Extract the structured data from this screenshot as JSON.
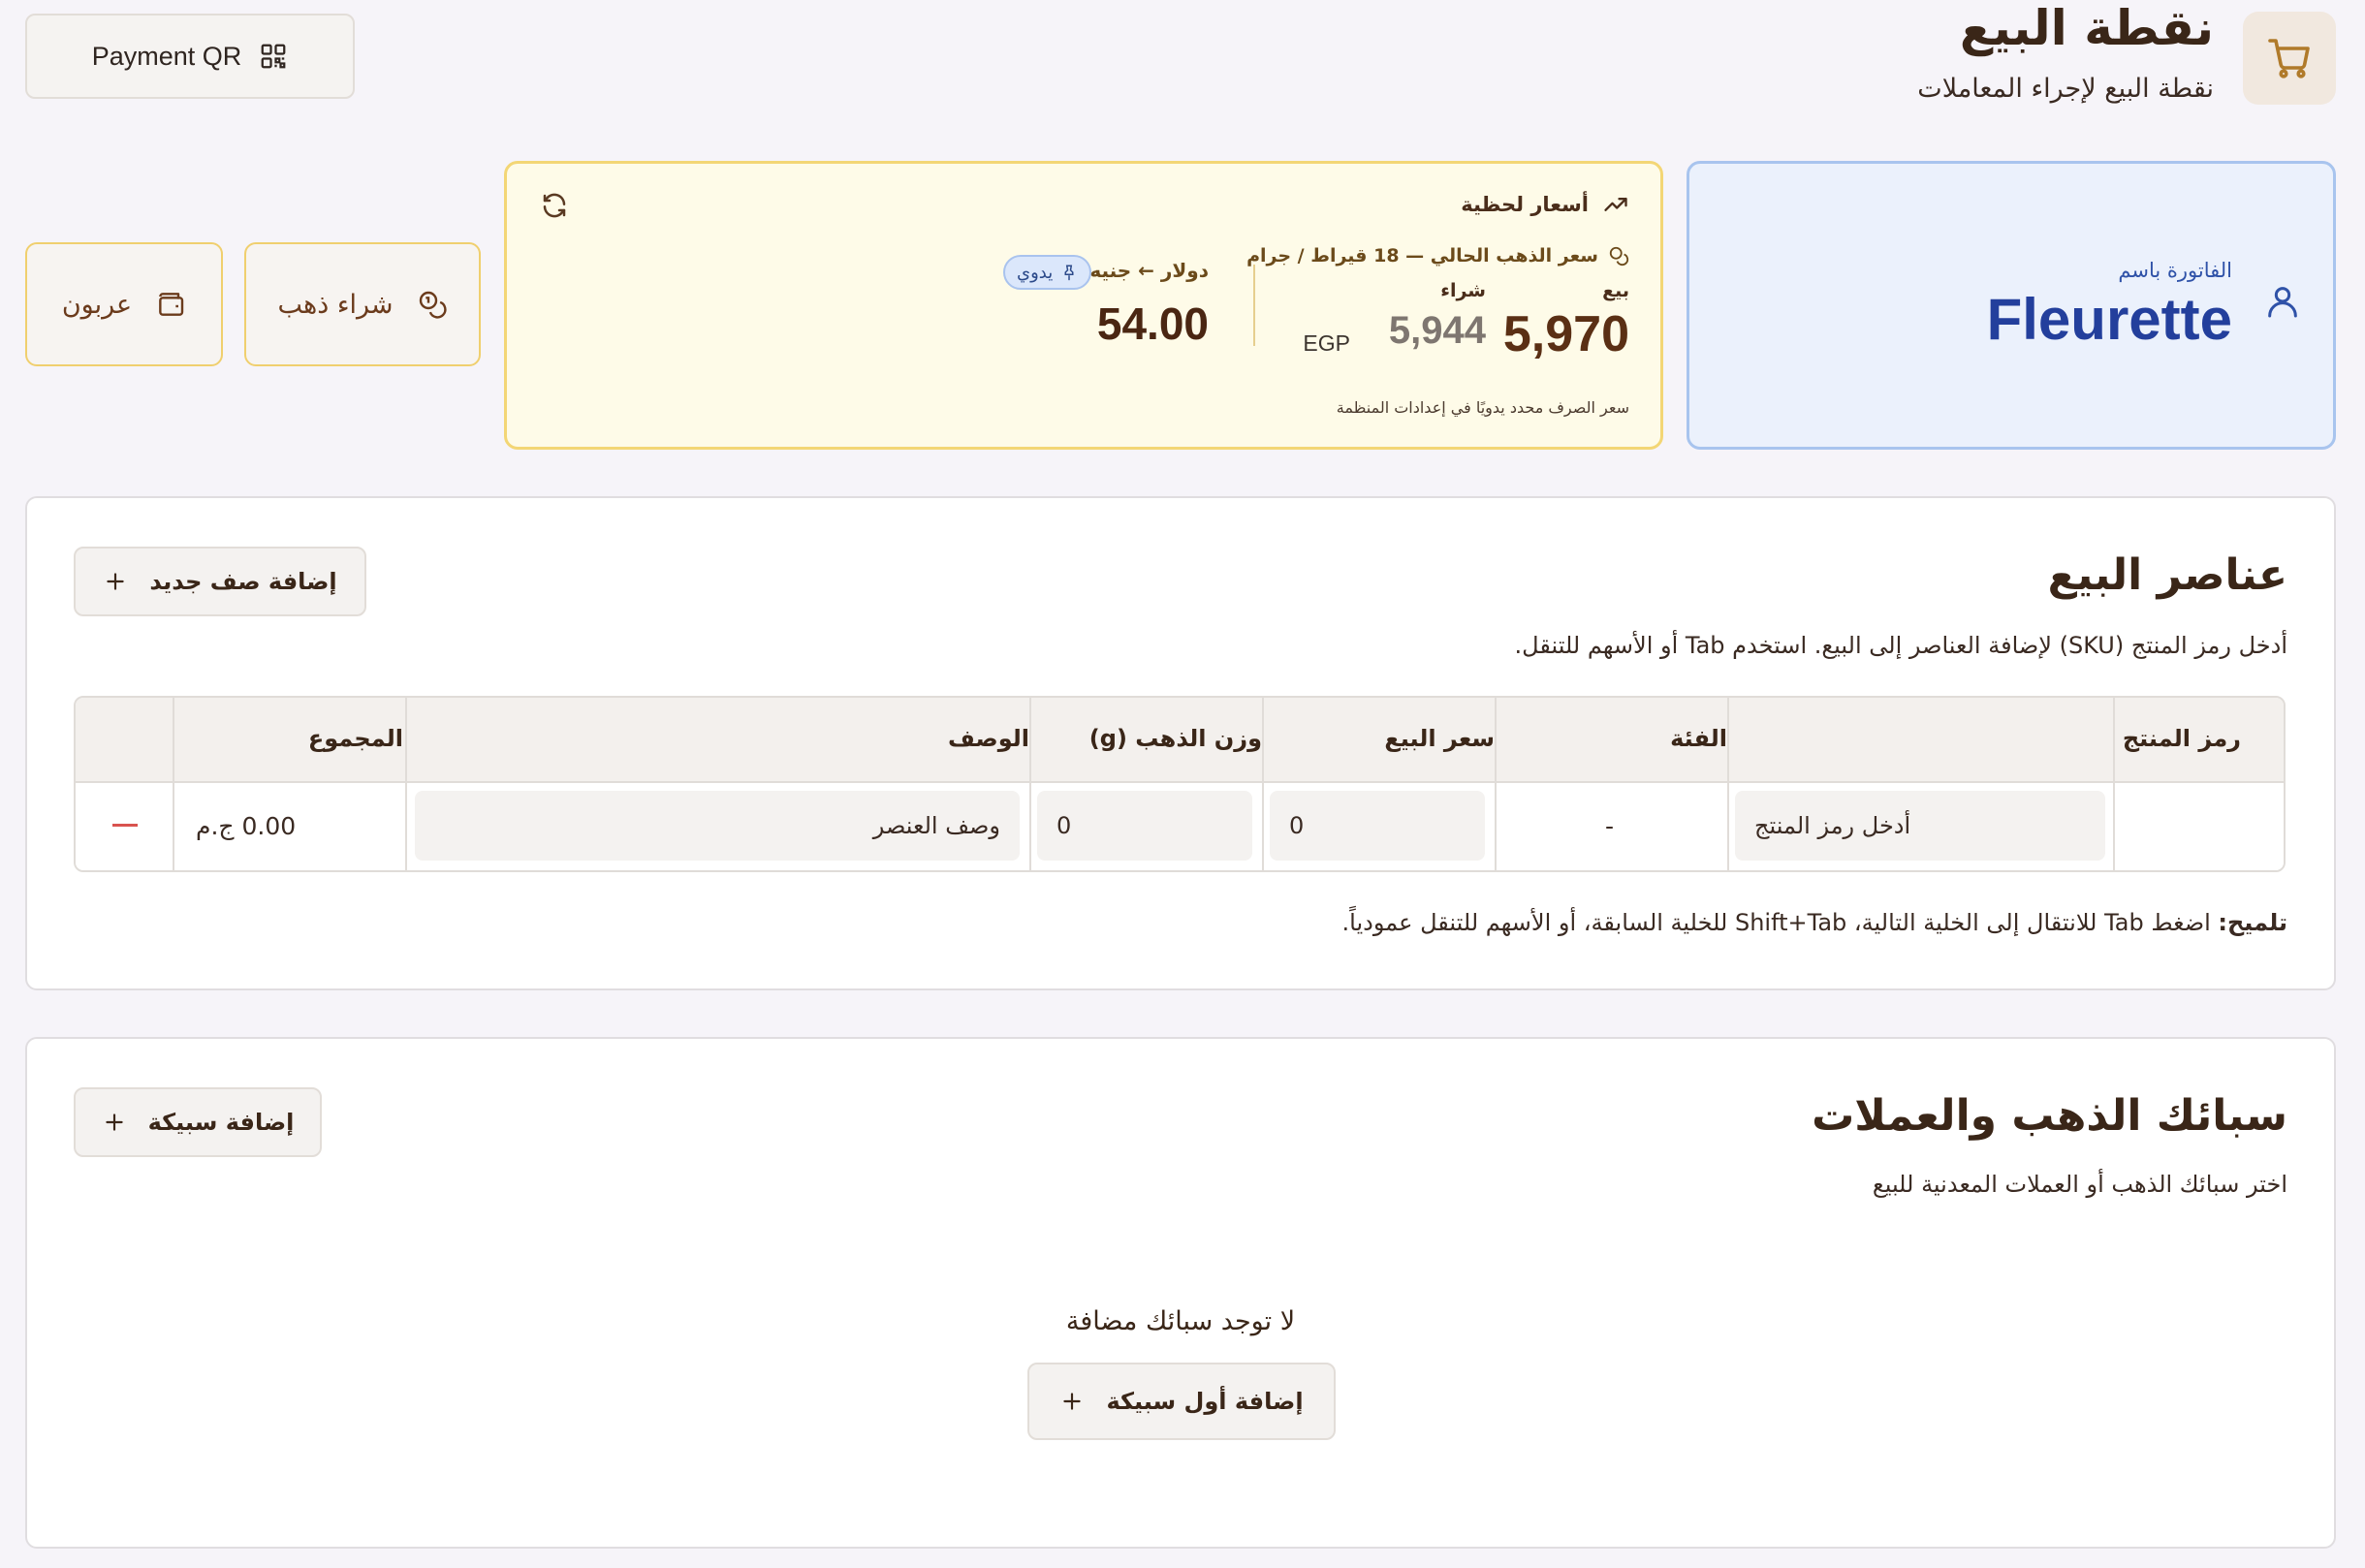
{
  "header": {
    "title": "نقطة البيع",
    "subtitle": "نقطة البيع لإجراء المعاملات",
    "payment_qr_label": "Payment QR",
    "cart_icon": "cart-icon",
    "qr_icon": "qr-code-icon"
  },
  "actions": {
    "deposit_label": "عربون",
    "buy_gold_label": "شراء ذهب"
  },
  "prices": {
    "title": "أسعار لحظية",
    "gold_label": "سعر الذهب الحالي — 18 قيراط / جرام",
    "sell_label": "بيع",
    "buy_label": "شراء",
    "sell_value": "5,970",
    "buy_value": "5,944",
    "currency": "EGP",
    "usd_label": "دولار ← جنيه",
    "manual_badge": "يدوي",
    "usd_value": "54.00",
    "rate_note": "سعر الصرف محدد يدويًا في إعدادات المنظمة"
  },
  "invoice": {
    "label": "الفاتورة باسم",
    "name": "Fleurette"
  },
  "sale_items": {
    "title": "عناصر البيع",
    "description": "أدخل رمز المنتج (SKU) لإضافة العناصر إلى البيع. استخدم Tab أو الأسهم للتنقل.",
    "add_row_label": "إضافة صف جديد",
    "columns": [
      "رمز المنتج",
      "الفئة",
      "سعر البيع",
      "وزن الذهب (g)",
      "الوصف",
      "المجموع"
    ],
    "row": {
      "sku_placeholder": "أدخل رمز المنتج",
      "category": "-",
      "price": "0",
      "weight": "0",
      "desc_placeholder": "وصف العنصر",
      "total": "0.00 ج.م"
    },
    "hint_bold": "تلميح:",
    "hint_text": " اضغط Tab للانتقال إلى الخلية التالية، Shift+Tab للخلية السابقة، أو الأسهم للتنقل عمودياً."
  },
  "gold_bars": {
    "title": "سبائك الذهب والعملات",
    "description": "اختر سبائك الذهب أو العملات المعدنية للبيع",
    "add_bar_label": "إضافة سبيكة",
    "empty_message": "لا توجد سبائك مضافة",
    "add_first_label": "إضافة أول سبيكة"
  },
  "colors": {
    "background": "#f6f4f9",
    "gold_border": "#f3d675",
    "gold_bg": "#fefbe8",
    "invoice_bg": "#ebf1fc",
    "invoice_accent": "#233f9c",
    "brown_text": "#3a2618",
    "remove_red": "#d9534f"
  }
}
